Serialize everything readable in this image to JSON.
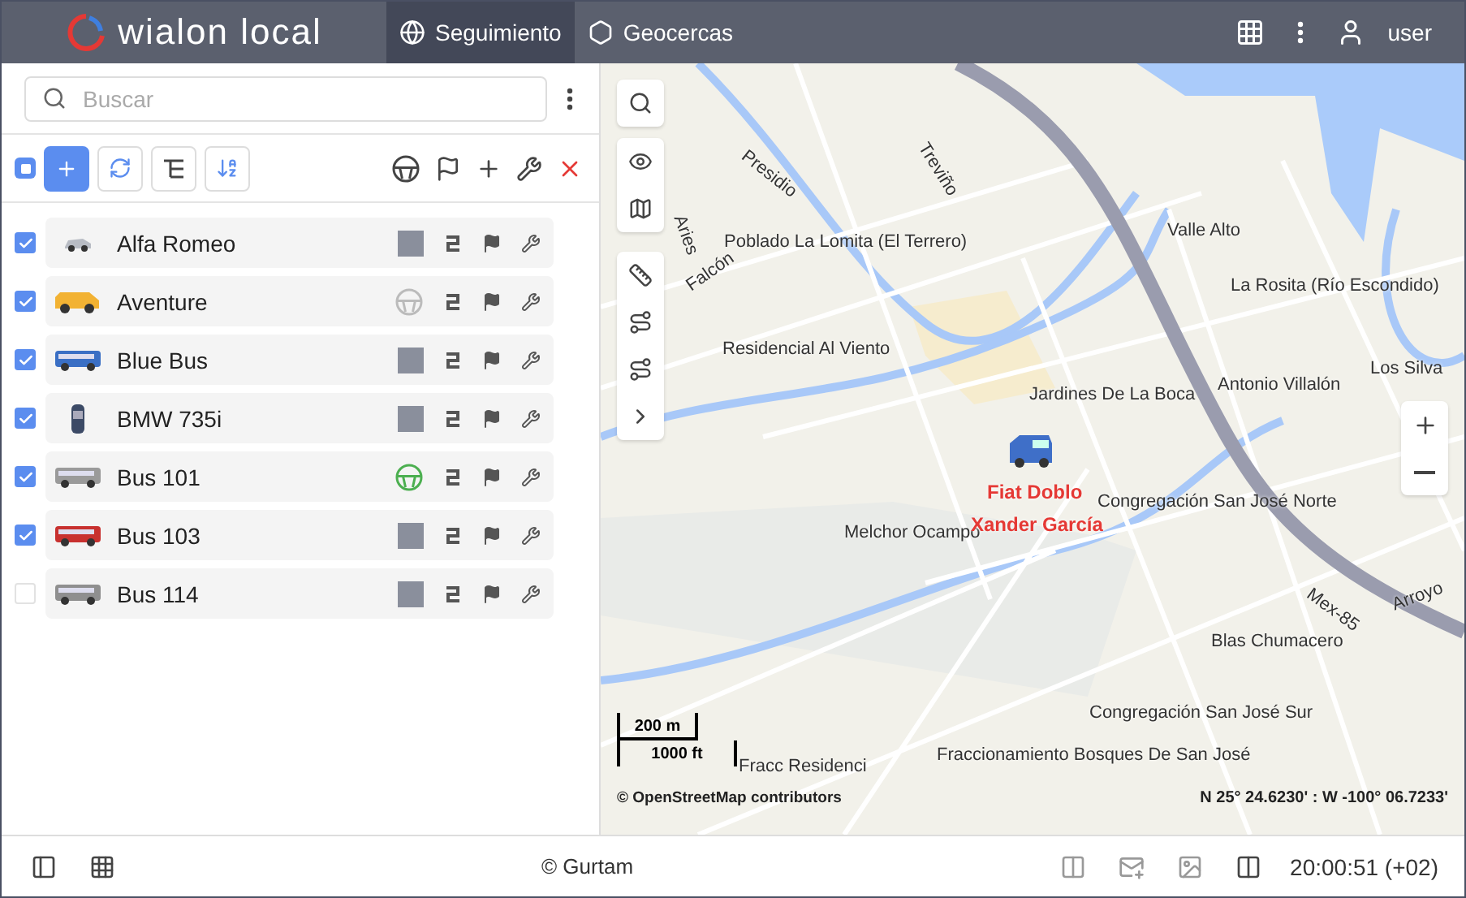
{
  "header": {
    "logo": "wialon local",
    "tabs": [
      {
        "label": "Seguimiento",
        "selected": true,
        "kind": "globe"
      },
      {
        "label": "Geocercas",
        "selected": false,
        "kind": "geofence"
      }
    ],
    "user": "user"
  },
  "sidebar": {
    "search": {
      "placeholder": "Buscar"
    },
    "select_all": {
      "indeterminate": true
    },
    "units": [
      {
        "name": "Alfa Romeo",
        "checked": true,
        "kind": "car",
        "color": "#b8bcc4",
        "has_photo": true
      },
      {
        "name": "Aventure",
        "checked": true,
        "kind": "van",
        "color": "#f2b233",
        "has_photo": false,
        "driver_bound": false
      },
      {
        "name": "Blue Bus",
        "checked": true,
        "kind": "bus",
        "color": "#3a6fc4",
        "has_photo": true
      },
      {
        "name": "BMW 735i",
        "checked": true,
        "kind": "topcar",
        "color": "#3c4a66",
        "has_photo": true
      },
      {
        "name": "Bus 101",
        "checked": true,
        "kind": "bus",
        "color": "#9a9a9a",
        "has_photo": false,
        "driver_bound": true
      },
      {
        "name": "Bus 103",
        "checked": true,
        "kind": "bus",
        "color": "#c8312f",
        "has_photo": true
      },
      {
        "name": "Bus 114",
        "checked": false,
        "kind": "bus",
        "color": "#8f8f8f",
        "has_photo": true
      }
    ]
  },
  "map": {
    "places": [
      "Presidio",
      "Treviño",
      "Aries",
      "Falcón",
      "Poblado La Lomita (El Terrero)",
      "Valle Alto",
      "La Rosita (Río Escondido)",
      "Residencial Al Viento",
      "Jardines De La Boca",
      "Antonio Villalón",
      "Los Silva",
      "Congregación San José Norte",
      "Melchor Ocampo",
      "Mex-85",
      "Arroyo",
      "Blas Chumacero",
      "Congregación San José Sur",
      "Fraccionamiento Bosques De San José",
      "Fracc Residenci"
    ],
    "unit": {
      "name": "Fiat Doblo",
      "driver": "Xander García"
    },
    "scale": {
      "metric": "200 m",
      "imperial": "1000 ft"
    },
    "attribution": "© OpenStreetMap contributors",
    "coordinates": "N 25° 24.6230' : W -100° 06.7233'"
  },
  "footer": {
    "copyright": "© Gurtam",
    "time": "20:00:51 (+02)"
  }
}
